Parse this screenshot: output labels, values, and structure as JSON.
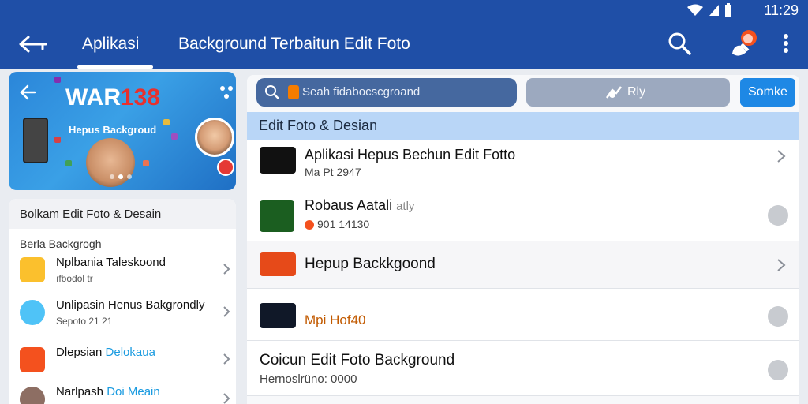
{
  "status_bar": {
    "time": "11:29"
  },
  "app_bar": {
    "tab_active": "Aplikasi",
    "tab_title": "Background Terbaitun Edit Foto"
  },
  "banner": {
    "title_white": "WAR",
    "title_red": "138",
    "subtitle": "Hepus Backgroud"
  },
  "left_list": {
    "header": "Bolkam Edit Foto & Desain",
    "section_label": "Berla Backgrogh",
    "items": [
      {
        "title": "Nplbania Taleskoond",
        "meta": "ıfbodol tr"
      },
      {
        "title": "Unlipasin Henus Bakgrondly",
        "meta": "Sepoto 21 21"
      },
      {
        "title": "Dlepsian",
        "title_accent": "Delokaua",
        "meta": ""
      },
      {
        "title": "Narlpash",
        "title_accent": "Doi Meain",
        "meta": ""
      }
    ]
  },
  "toolbar": {
    "search_value": "Seah fidabocscgroand",
    "filter_label": "Rly",
    "primary_button": "Somke"
  },
  "right_list": {
    "section_header": "Edit Foto & Desian",
    "items": [
      {
        "title": "Aplikasi Hepus Bechun Edit Fotto",
        "meta": "Ma Pt 2947",
        "action": "chevron"
      },
      {
        "title": "Robaus Aatali",
        "title_suffix": "atly",
        "meta": "901 14130",
        "action": "download"
      },
      {
        "title": "Hepup Backkgoond",
        "meta": "",
        "action": "chevron"
      },
      {
        "title": "Mpi Hof40",
        "meta": "",
        "action": "download"
      },
      {
        "title": "Coicun Edit Foto Background",
        "meta": "Hernoslrüno: 0000",
        "action": "download"
      }
    ]
  },
  "colors": {
    "app_bar": "#1f4fa7",
    "accent_blue": "#1e88e5",
    "section_header": "#b9d6f7"
  },
  "icons": [
    "back-arrow-icon",
    "search-icon",
    "avatar-icon",
    "more-vert-icon",
    "wifi-icon",
    "signal-icon",
    "battery-icon",
    "share-icon",
    "chevron-right-icon",
    "download-icon",
    "filter-icon"
  ]
}
